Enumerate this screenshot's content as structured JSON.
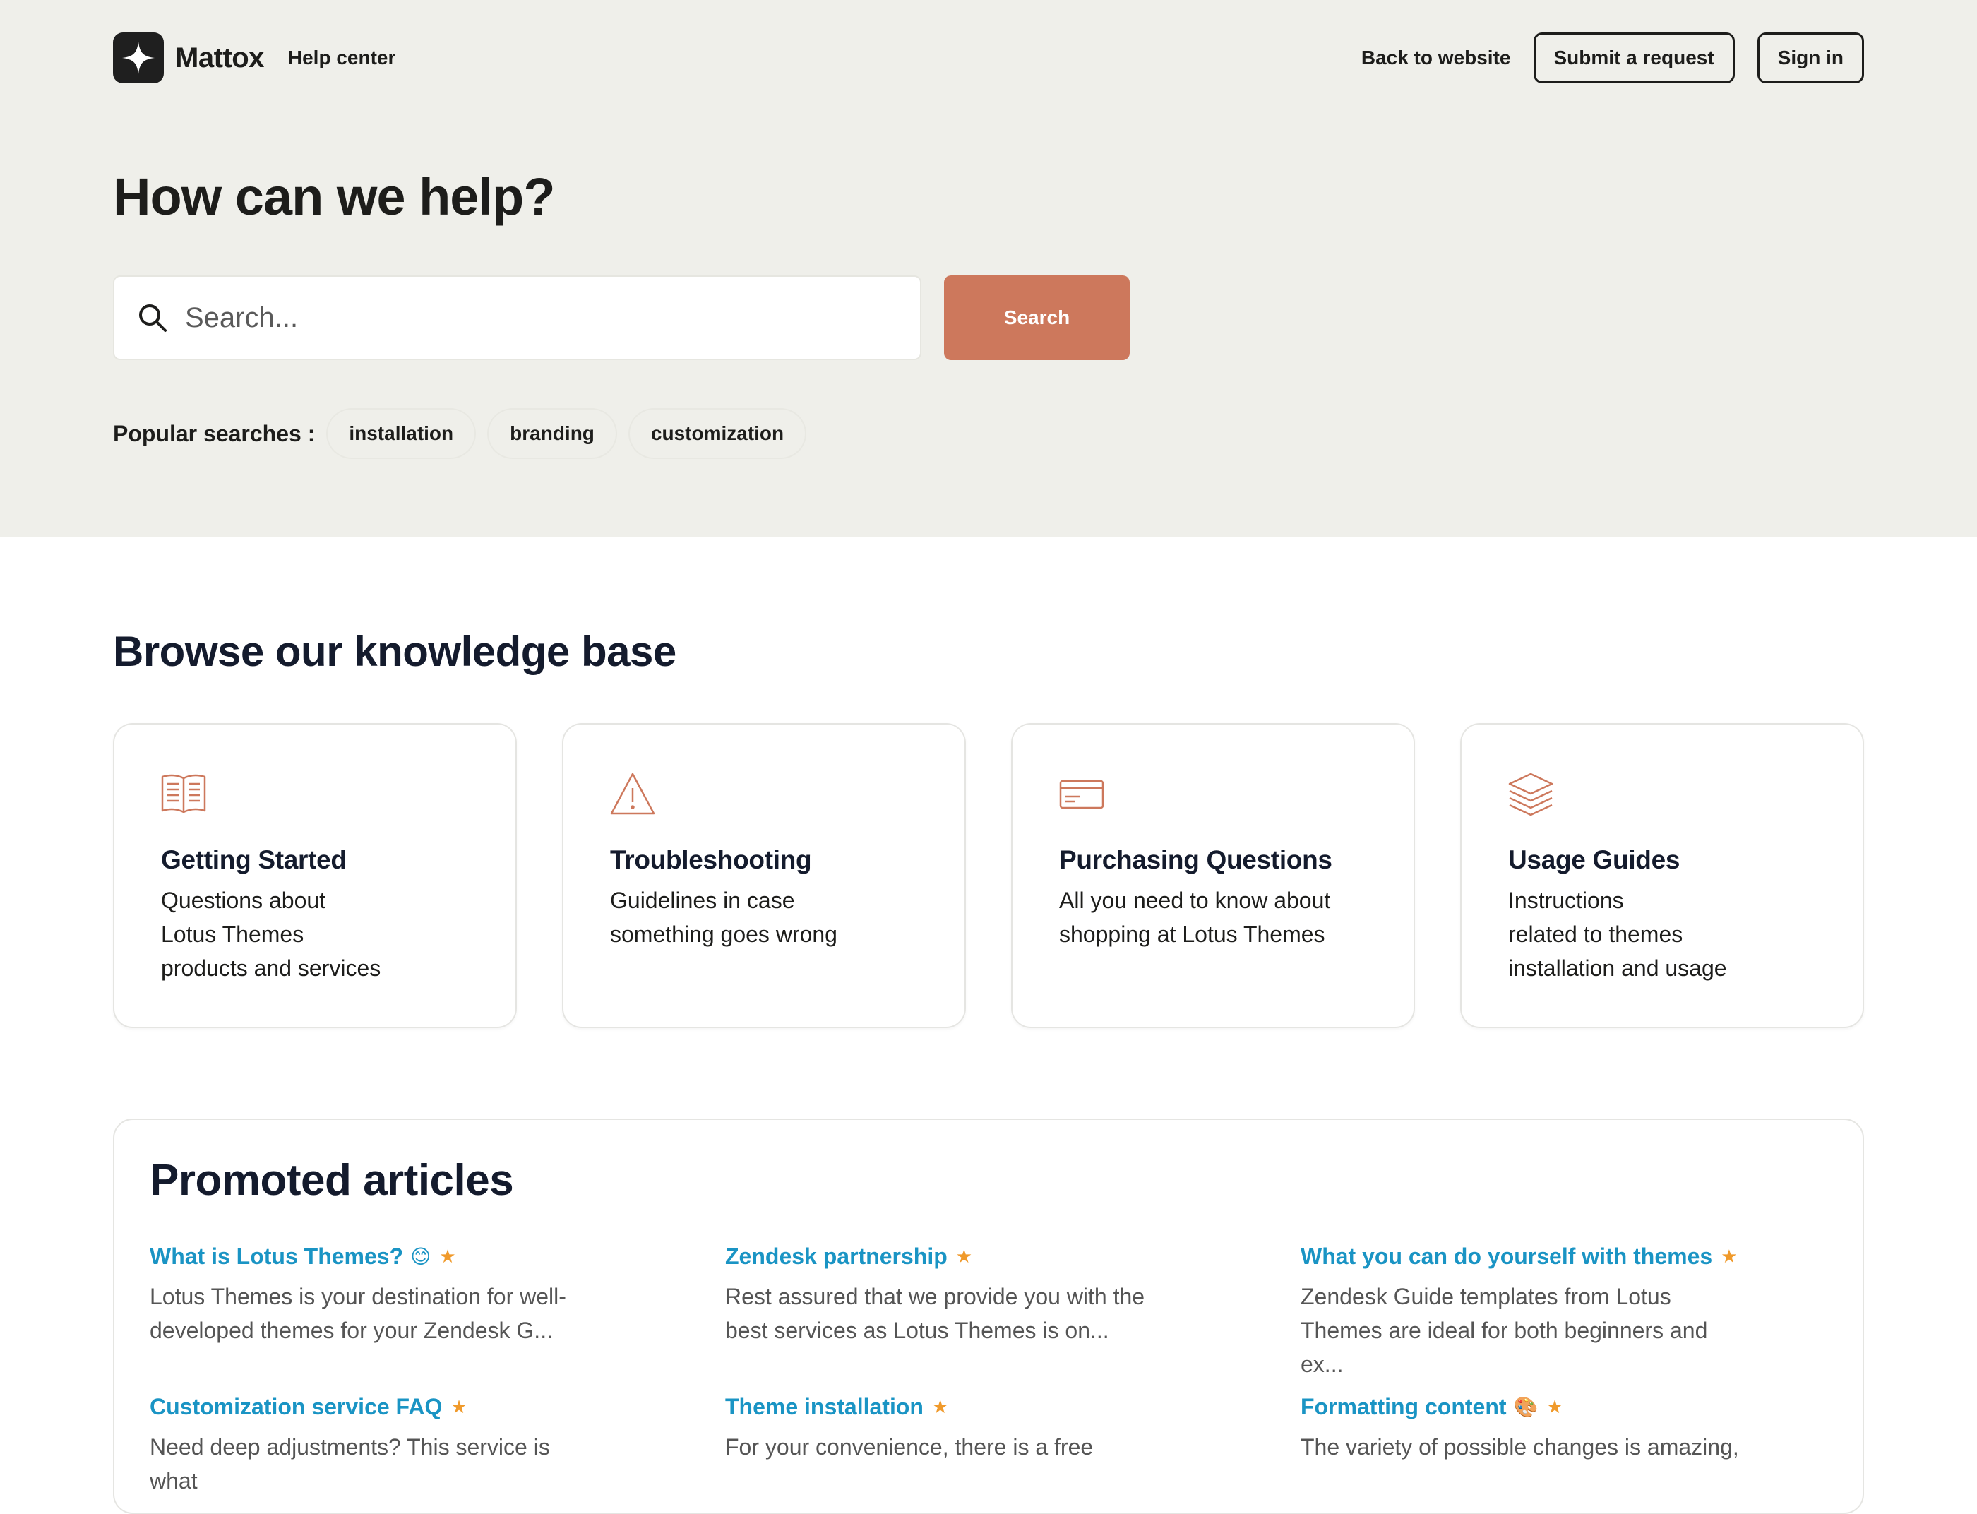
{
  "header": {
    "brand": "Mattox",
    "subtitle": "Help center",
    "back_link": "Back to website",
    "submit_request": "Submit a request",
    "sign_in": "Sign in"
  },
  "hero": {
    "title": "How can we help?",
    "search_placeholder": "Search...",
    "search_button": "Search",
    "popular_label": "Popular searches :",
    "popular_searches": [
      "installation",
      "branding",
      "customization"
    ]
  },
  "knowledge_base": {
    "title": "Browse our knowledge base",
    "categories": [
      {
        "icon": "book-icon",
        "title": "Getting Started",
        "desc_lines": [
          "Questions about",
          "Lotus Themes",
          "products and services"
        ]
      },
      {
        "icon": "warning-icon",
        "title": "Troubleshooting",
        "desc_lines": [
          "Guidelines in case",
          "something goes wrong"
        ]
      },
      {
        "icon": "credit-card-icon",
        "title": "Purchasing Questions",
        "desc_lines": [
          "All you need to know about",
          "shopping at Lotus Themes"
        ]
      },
      {
        "icon": "layers-icon",
        "title": "Usage Guides",
        "desc_lines": [
          "Instructions",
          "related to themes",
          "installation and usage"
        ]
      }
    ]
  },
  "promoted": {
    "title": "Promoted articles",
    "articles": [
      {
        "title": "What is Lotus Themes?",
        "emoji": "😊",
        "excerpt_lines": [
          "Lotus Themes is your destination for well-",
          "developed themes for your Zendesk G..."
        ]
      },
      {
        "title": "Zendesk partnership",
        "emoji": "",
        "excerpt_lines": [
          "Rest assured that we provide you with the",
          "best services as Lotus Themes is on..."
        ]
      },
      {
        "title": "What you can do yourself with themes",
        "emoji": "",
        "excerpt_lines": [
          "Zendesk Guide templates from Lotus",
          "Themes are ideal for both beginners and ex..."
        ]
      },
      {
        "title": "Customization service FAQ",
        "emoji": "",
        "excerpt_lines": [
          "Need deep adjustments? This service is what",
          ""
        ]
      },
      {
        "title": "Theme installation",
        "emoji": "",
        "excerpt_lines": [
          "For your convenience, there is a free",
          ""
        ]
      },
      {
        "title": "Formatting content",
        "emoji": "🎨",
        "excerpt_lines": [
          "The variety of possible changes is amazing,",
          ""
        ]
      }
    ],
    "star_glyph": "★"
  },
  "colors": {
    "hero_bg": "#efefea",
    "accent": "#cd785c",
    "link": "#1a94c4",
    "star": "#f09a2b"
  }
}
